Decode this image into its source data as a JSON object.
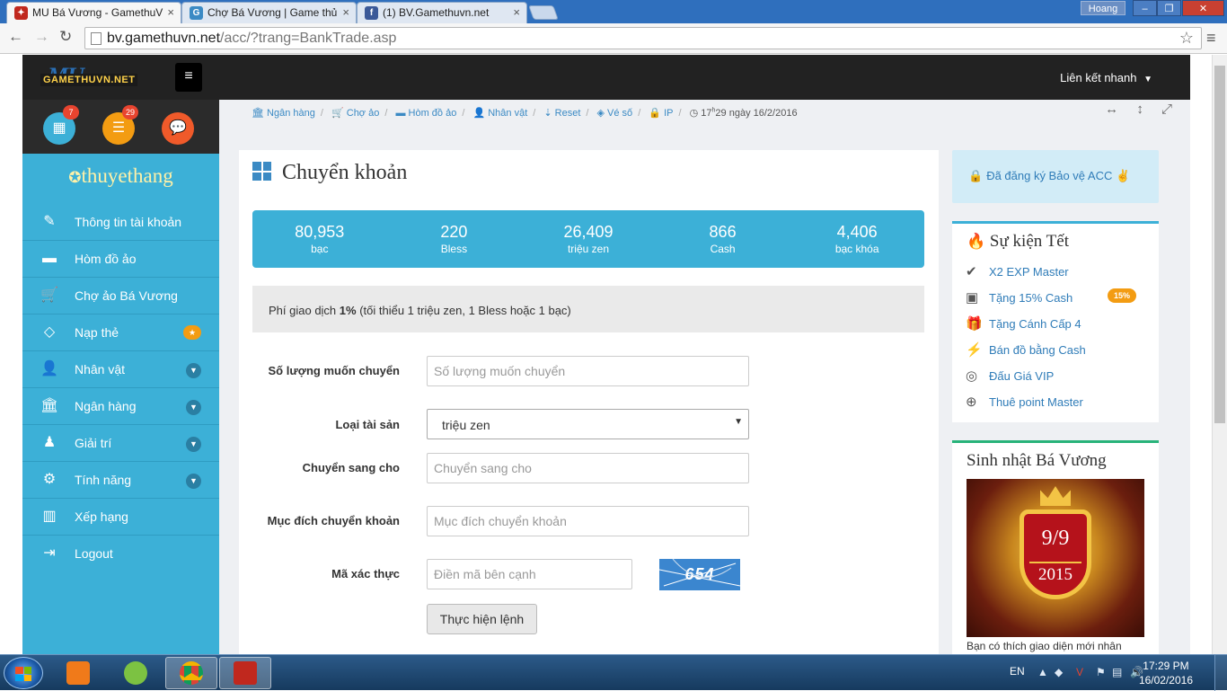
{
  "browser": {
    "tabs": [
      {
        "title": "MU Bá Vương - GamethuV",
        "active": true,
        "favicon": "mu-icon"
      },
      {
        "title": "Chợ Bá Vương | Game thủ",
        "active": false,
        "favicon": "g-icon"
      },
      {
        "title": "(1) BV.Gamethuvn.net",
        "active": false,
        "favicon": "facebook-icon"
      }
    ],
    "user_badge": "Hoang",
    "url_host": "bv.gamethuvn.net",
    "url_path": "/acc/?trang=BankTrade.asp"
  },
  "header": {
    "logo_mu": "MU",
    "logo_text": "GAMETHUVN.NET",
    "quick_link": "Liên kết nhanh"
  },
  "sidebar": {
    "badges": {
      "calendar": "7",
      "list": "29"
    },
    "username": "thuyethang",
    "items": [
      {
        "label": "Thông tin tài khoản",
        "icon": "edit-icon"
      },
      {
        "label": "Hòm đồ ảo",
        "icon": "briefcase-icon"
      },
      {
        "label": "Chợ ảo Bá Vương",
        "icon": "cart-icon"
      },
      {
        "label": "Nạp thẻ",
        "icon": "diamond-icon"
      },
      {
        "label": "Nhân vật",
        "icon": "user-icon"
      },
      {
        "label": "Ngân hàng",
        "icon": "bank-icon"
      },
      {
        "label": "Giải trí",
        "icon": "android-icon"
      },
      {
        "label": "Tính năng",
        "icon": "cogs-icon"
      },
      {
        "label": "Xếp hạng",
        "icon": "bar-chart-icon"
      },
      {
        "label": "Logout",
        "icon": "logout-icon"
      }
    ]
  },
  "breadcrumb": {
    "items": [
      "Ngân hàng",
      "Chợ ảo",
      "Hòm đồ ảo",
      "Nhân vật",
      "Reset",
      "Vé số",
      "IP"
    ],
    "time_hour": "17",
    "time_sup": "h",
    "time_rest": "29 ngày 16/2/2016"
  },
  "main": {
    "title": "Chuyển khoản",
    "stats": [
      {
        "value": "80,953",
        "label": "bạc"
      },
      {
        "value": "220",
        "label": "Bless"
      },
      {
        "value": "26,409",
        "label": "triệu zen"
      },
      {
        "value": "866",
        "label": "Cash"
      },
      {
        "value": "4,406",
        "label": "bạc khóa"
      }
    ],
    "fee_prefix": "Phí giao dịch ",
    "fee_percent": "1%",
    "fee_suffix": " (tối thiểu 1 triệu zen, 1 Bless hoặc 1 bạc)",
    "form": {
      "amount_label": "Số lượng muốn chuyển",
      "amount_placeholder": "Số lượng muốn chuyển",
      "asset_label": "Loại tài sản",
      "asset_value": "triệu zen",
      "to_label": "Chuyển sang cho",
      "to_placeholder": "Chuyển sang cho",
      "purpose_label": "Mục đích chuyển khoản",
      "purpose_placeholder": "Mục đích chuyển khoản",
      "captcha_label": "Mã xác thực",
      "captcha_placeholder": "Điền mã bên cạnh",
      "captcha_code": "654",
      "submit_label": "Thực hiện lệnh"
    }
  },
  "right": {
    "protect_text": "Đã đăng ký Bảo vệ ACC",
    "events_title": "Sự kiện Tết",
    "events": [
      {
        "label": "X2 EXP Master",
        "icon": "check-circle-icon"
      },
      {
        "label": "Tặng 15% Cash",
        "icon": "money-icon"
      },
      {
        "label": "Tặng Cánh Cấp 4",
        "icon": "gift-icon"
      },
      {
        "label": "Bán đồ bằng Cash",
        "icon": "plug-icon"
      },
      {
        "label": "Đấu Giá VIP",
        "icon": "chrome-icon"
      },
      {
        "label": "Thuê point Master",
        "icon": "plus-circle-icon"
      }
    ],
    "event_badge": "15%",
    "birthday_title": "Sinh nhật Bá Vương",
    "birthday_date": "9/9",
    "birthday_year": "2015",
    "birthday_text": "Bạn có thích giao diện mới nhân"
  },
  "taskbar": {
    "lang": "EN",
    "time": "17:29 PM",
    "date": "16/02/2016"
  }
}
